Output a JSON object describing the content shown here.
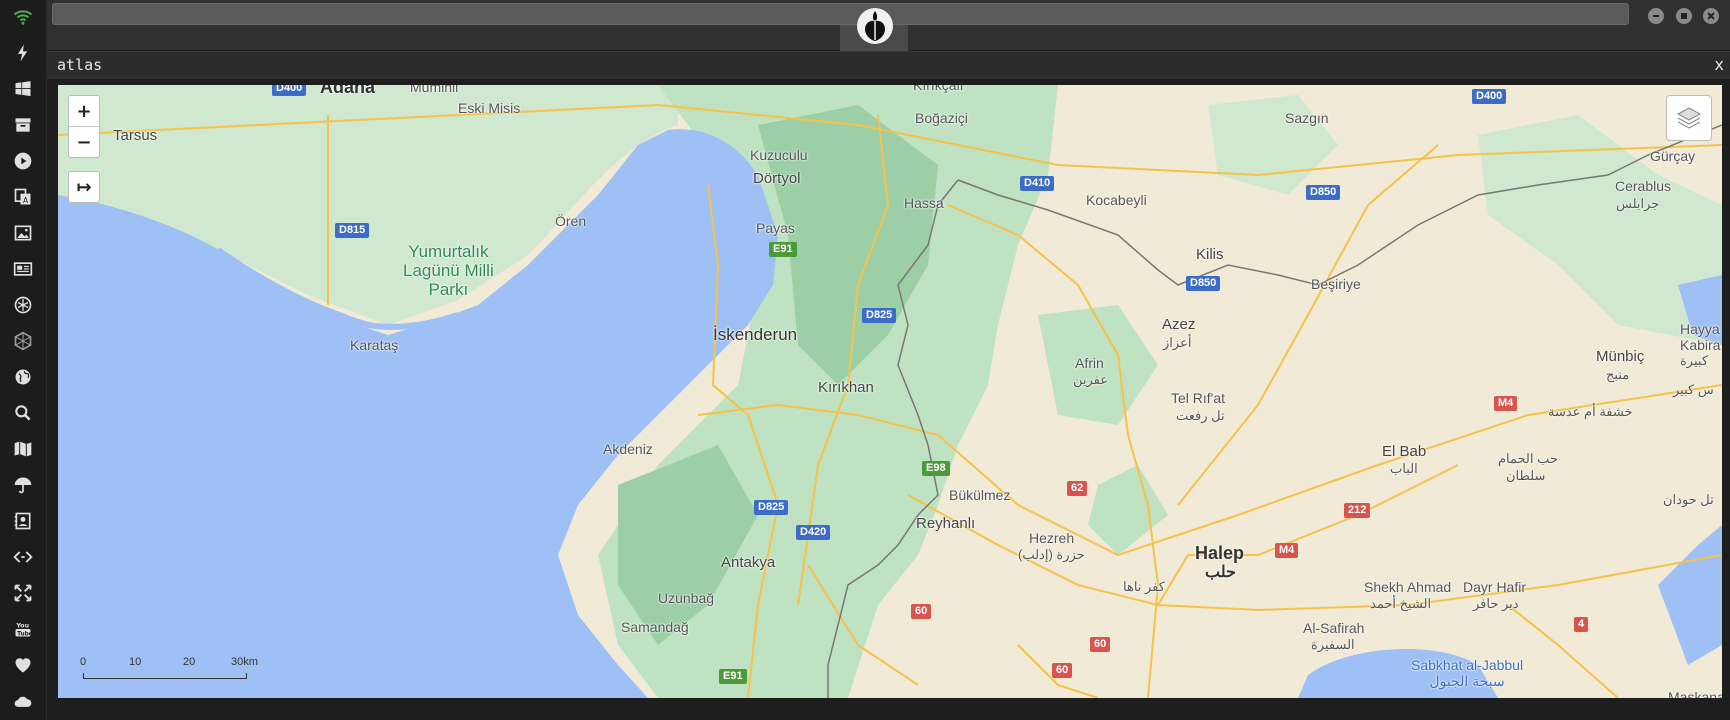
{
  "window": {
    "title": "atlas",
    "close_label": "x"
  },
  "sidebar": {
    "icons": [
      "wifi-icon",
      "lightning-icon",
      "windows-icon",
      "archive-icon",
      "play-icon",
      "translate-icon",
      "image-icon",
      "news-icon",
      "rebel-icon",
      "hexagon-icon",
      "globe-icon",
      "search-icon",
      "map-icon",
      "umbrella-icon",
      "contact-card-icon",
      "code-icon",
      "expand-icon",
      "youtube-icon",
      "heart-icon",
      "cloud-icon"
    ]
  },
  "map": {
    "zoom_in": "+",
    "zoom_out": "−",
    "expand": "↦",
    "scale": {
      "ticks": [
        "0",
        "10",
        "20",
        "30km"
      ]
    },
    "labels": {
      "adana": "Adana",
      "muminli": "Muminli",
      "eski_misis": "Eski Misis",
      "tarsus": "Tarsus",
      "kirikcali": "Kırıkçalı",
      "bogazici": "Boğaziçi",
      "sazgin": "Sazgın",
      "gurcay": "Gürçay",
      "kuzuculu": "Kuzuculu",
      "dortyol": "Dörtyol",
      "hassa": "Hassa",
      "kocabeyli": "Kocabeyli",
      "cerablus": "Cerablus",
      "cerablus_ar": "جرابلس",
      "oren": "Ören",
      "park_line1": "Yumurtalık",
      "park_line2": "Lagünü Milli",
      "park_line3": "Parkı",
      "payas": "Payas",
      "kilis": "Kilis",
      "besiriye": "Beşiriye",
      "karatas": "Karataş",
      "azez": "Azez",
      "azez_ar": "أعزاز",
      "iskenderun": "İskenderun",
      "hayya": "Hayya",
      "kabira": "Kabira",
      "kabira_ar": "كبيرة",
      "kirikhan": "Kırıkhan",
      "afrin": "Afrin",
      "afrin_ar": "عفرين",
      "munbic": "Münbiç",
      "munbic_ar": "منبج",
      "kabir_ar": "س كبير",
      "telrifat": "Tel Rıf'at",
      "telrifat_ar": "تل رفعت",
      "akdeniz": "Akdeniz",
      "khashfa_ar": "خشفة أم عدسة",
      "elbab": "El Bab",
      "elbab_ar": "الباب",
      "habhamam_ar1": "حب الحمام",
      "habhamam_ar2": "سلطان",
      "bukulmez": "Bükülmez",
      "tel_hawdan_ar": "تل حودان",
      "reyhanli": "Reyhanlı",
      "hezreh": "Hezreh",
      "hezreh_ar": "حزرة (إدلب)",
      "halep": "Halep",
      "halep_ar": "حلب",
      "antakya": "Antakya",
      "kafr_naha_ar": "كفر ناها",
      "shekh_ahmad": "Shekh Ahmad",
      "shekh_ahmad_ar": "الشيخ أحمد",
      "dayr_hafir": "Dayr Hafir",
      "dayr_hafir_ar": "دير حافر",
      "uzunbag": "Uzunbağ",
      "samandag": "Samandağ",
      "alsafirah": "Al-Safirah",
      "alsafirah_ar": "السفيرة",
      "sabkhat_line1": "Sabkhat al-Jabbul",
      "sabkhat_line2": "سبخة الجبول",
      "maskana": "Maskana"
    },
    "shields": {
      "d400_a": "D400",
      "d400_b": "D400",
      "d410": "D410",
      "d850_a": "D850",
      "d850_b": "D850",
      "d815": "D815",
      "e91_a": "E91",
      "e91_b": "E91",
      "d825_a": "D825",
      "d825_b": "D825",
      "e98": "E98",
      "d420": "D420",
      "r62": "62",
      "r60_a": "60",
      "r60_b": "60",
      "r60_c": "60",
      "m4_a": "M4",
      "m4_b": "M4",
      "r212": "212",
      "r4": "4"
    },
    "colors": {
      "sea": "#9ec0f5",
      "land": "#f1ead7",
      "green": "#bfe3c2",
      "dark_green": "#9ccfa5",
      "road": "#f6c24a",
      "border": "#777777"
    }
  }
}
